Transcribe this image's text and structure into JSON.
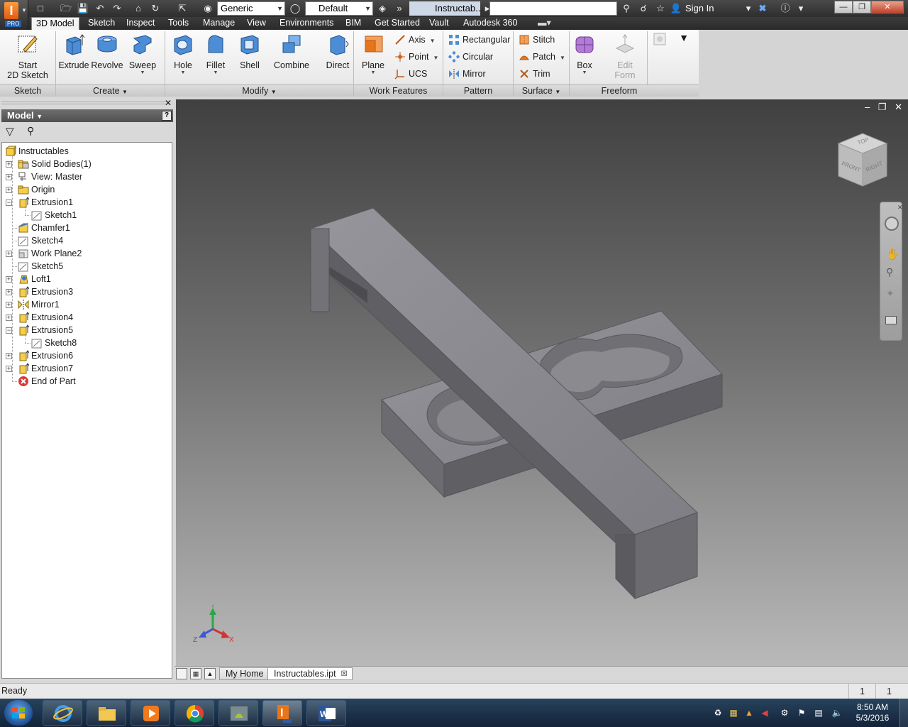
{
  "titlebar": {
    "material_combo": "Generic",
    "appearance_combo": "Default",
    "doc_title": "Instructab...",
    "sign_in": "Sign In",
    "pro_badge": "PRO"
  },
  "tabs": [
    {
      "label": "3D Model",
      "active": true
    },
    {
      "label": "Sketch"
    },
    {
      "label": "Inspect"
    },
    {
      "label": "Tools"
    },
    {
      "label": "Manage"
    },
    {
      "label": "View"
    },
    {
      "label": "Environments"
    },
    {
      "label": "BIM"
    },
    {
      "label": "Get Started"
    },
    {
      "label": "Vault"
    },
    {
      "label": "Autodesk 360"
    }
  ],
  "ribbon": {
    "sketch": {
      "start_line1": "Start",
      "start_line2": "2D Sketch",
      "panel": "Sketch"
    },
    "create": {
      "extrude": "Extrude",
      "revolve": "Revolve",
      "sweep": "Sweep",
      "panel": "Create"
    },
    "modify": {
      "hole": "Hole",
      "fillet": "Fillet",
      "shell": "Shell",
      "combine": "Combine",
      "direct": "Direct",
      "panel": "Modify"
    },
    "work_features": {
      "plane": "Plane",
      "axis": "Axis",
      "point": "Point",
      "ucs": "UCS",
      "panel": "Work Features"
    },
    "pattern": {
      "rectangular": "Rectangular",
      "circular": "Circular",
      "mirror": "Mirror",
      "panel": "Pattern"
    },
    "surface": {
      "stitch": "Stitch",
      "patch": "Patch",
      "trim": "Trim",
      "panel": "Surface"
    },
    "freeform": {
      "box": "Box",
      "edit_line1": "Edit",
      "edit_line2": "Form",
      "panel": "Freeform"
    }
  },
  "browser": {
    "title": "Model",
    "tree": [
      {
        "label": "Instructables",
        "icon": "part-icon",
        "level": 0
      },
      {
        "label": "Solid Bodies(1)",
        "icon": "folder-solid-icon",
        "level": 1,
        "expander": "+"
      },
      {
        "label": "View: Master",
        "icon": "view-icon",
        "level": 1,
        "expander": "+"
      },
      {
        "label": "Origin",
        "icon": "folder-icon",
        "level": 1,
        "expander": "+"
      },
      {
        "label": "Extrusion1",
        "icon": "extrude-icon",
        "level": 1,
        "expander": "-"
      },
      {
        "label": "Sketch1",
        "icon": "sketch-icon",
        "level": 2
      },
      {
        "label": "Chamfer1",
        "icon": "chamfer-icon",
        "level": 1
      },
      {
        "label": "Sketch4",
        "icon": "sketch-icon",
        "level": 1
      },
      {
        "label": "Work Plane2",
        "icon": "workplane-icon",
        "level": 1,
        "expander": "+"
      },
      {
        "label": "Sketch5",
        "icon": "sketch-icon",
        "level": 1
      },
      {
        "label": "Loft1",
        "icon": "loft-icon",
        "level": 1,
        "expander": "+"
      },
      {
        "label": "Extrusion3",
        "icon": "extrude-icon",
        "level": 1,
        "expander": "+"
      },
      {
        "label": "Mirror1",
        "icon": "mirror-icon",
        "level": 1,
        "expander": "+"
      },
      {
        "label": "Extrusion4",
        "icon": "extrude-icon",
        "level": 1,
        "expander": "+"
      },
      {
        "label": "Extrusion5",
        "icon": "extrude-icon",
        "level": 1,
        "expander": "-"
      },
      {
        "label": "Sketch8",
        "icon": "sketch-icon",
        "level": 2
      },
      {
        "label": "Extrusion6",
        "icon": "extrude-icon",
        "level": 1,
        "expander": "+"
      },
      {
        "label": "Extrusion7",
        "icon": "extrude-icon",
        "level": 1,
        "expander": "+"
      },
      {
        "label": "End of Part",
        "icon": "end-of-part-icon",
        "level": 1
      }
    ]
  },
  "viewcube": {
    "top": "TOP",
    "front": "FRONT",
    "right": "RIGHT"
  },
  "triad": {
    "x": "X",
    "y": "Y",
    "z": "Z"
  },
  "doc_tabs": [
    {
      "label": "My Home"
    },
    {
      "label": "Instructables.ipt",
      "active": true
    }
  ],
  "status": {
    "text": "Ready",
    "count1": "1",
    "count2": "1"
  },
  "taskbar": {
    "apps": [
      "ie-icon",
      "explorer-icon",
      "media-player-icon",
      "chrome-icon",
      "android-studio-icon",
      "inventor-icon",
      "word-icon"
    ],
    "time": "8:50 AM",
    "date": "5/3/2016"
  },
  "colors": {
    "accent": "#e8751a",
    "model": "#8f8f94",
    "tab_bar": "#2f2f2f"
  }
}
